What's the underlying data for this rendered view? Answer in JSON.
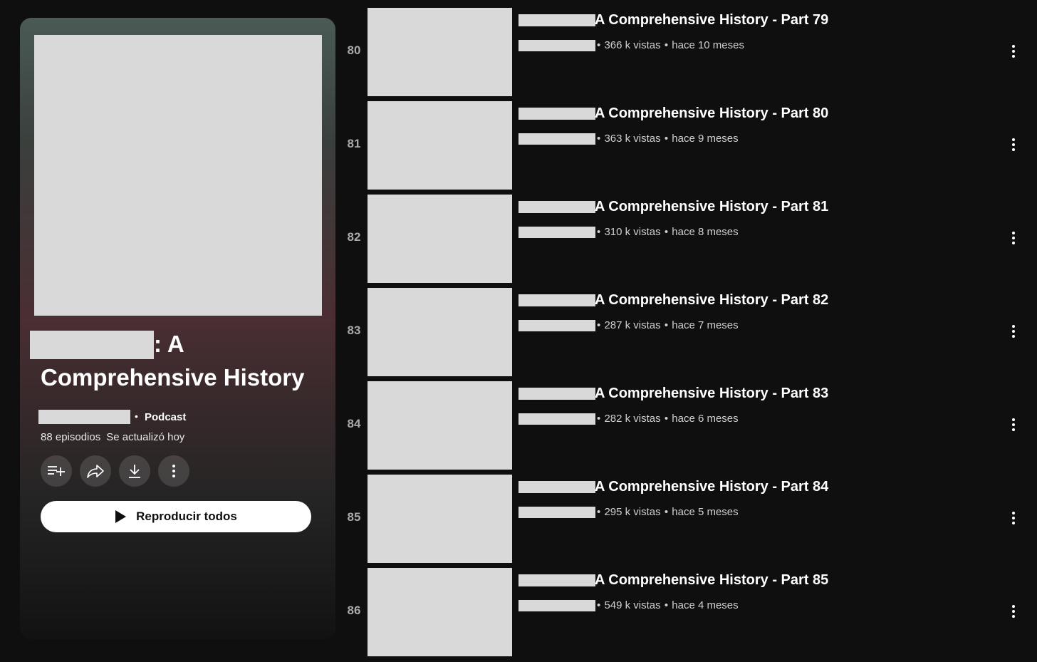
{
  "playlist": {
    "title_suffix": ": A",
    "title_line2": "Comprehensive History",
    "dot": "•",
    "type_label": "Podcast",
    "episode_count": "88 episodios",
    "updated": "Se actualizó hoy",
    "play_all_label": "Reproducir todos",
    "actions": [
      "add-to-queue-icon",
      "share-icon",
      "download-icon",
      "more-vert-icon"
    ]
  },
  "episodes": [
    {
      "index": "80",
      "title": "A Comprehensive History - Part 79",
      "views": "366 k vistas",
      "age": "hace 10 meses"
    },
    {
      "index": "81",
      "title": "A Comprehensive History - Part 80",
      "views": "363 k vistas",
      "age": "hace 9 meses"
    },
    {
      "index": "82",
      "title": "A Comprehensive History - Part 81",
      "views": "310 k vistas",
      "age": "hace 8 meses"
    },
    {
      "index": "83",
      "title": "A Comprehensive History - Part 82",
      "views": "287 k vistas",
      "age": "hace 7 meses"
    },
    {
      "index": "84",
      "title": "A Comprehensive History - Part 83",
      "views": "282 k vistas",
      "age": "hace 6 meses"
    },
    {
      "index": "85",
      "title": "A Comprehensive History - Part 84",
      "views": "295 k vistas",
      "age": "hace 5 meses"
    },
    {
      "index": "86",
      "title": "A Comprehensive History - Part 85",
      "views": "549 k vistas",
      "age": "hace 4 meses"
    }
  ],
  "meta_separator": "•",
  "colors": {
    "background": "#0f0f0f",
    "placeholder": "#d9d9d9",
    "button_bg": "#ffffff"
  }
}
